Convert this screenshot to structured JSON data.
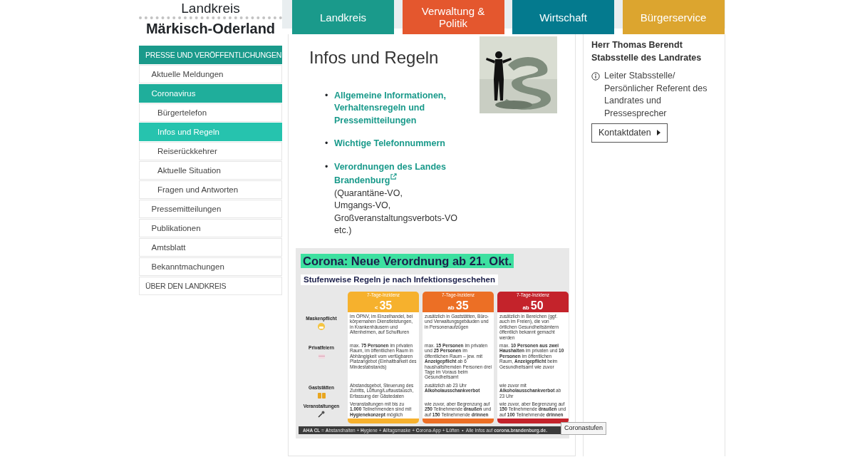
{
  "logo": {
    "line1": "Landkreis",
    "line2": "Märkisch-Oderland"
  },
  "nav_tabs": [
    {
      "label": "Landkreis",
      "color": "#1a9a8b"
    },
    {
      "label": "Verwaltung & Politik",
      "color": "#e4572e"
    },
    {
      "label": "Wirtschaft",
      "color": "#047a8e"
    },
    {
      "label": "Bürgerservice",
      "color": "#dca52f"
    }
  ],
  "sidebar": {
    "items": [
      {
        "label": "PRESSE UND VERÖFFENTLICHUNGEN",
        "expanded": true,
        "selected": false,
        "children": [
          {
            "label": "Aktuelle Meldungen",
            "expanded": false,
            "selected": false
          },
          {
            "label": "Coronavirus",
            "expanded": true,
            "selected": false,
            "children": [
              {
                "label": "Bürgertelefon",
                "expanded": false,
                "selected": false
              },
              {
                "label": "Infos und Regeln",
                "expanded": false,
                "selected": true
              },
              {
                "label": "Reiserückkehrer",
                "expanded": false,
                "selected": false
              },
              {
                "label": "Aktuelle Situation",
                "expanded": false,
                "selected": false
              },
              {
                "label": "Fragen und Antworten",
                "expanded": false,
                "selected": false
              }
            ]
          },
          {
            "label": "Pressemitteilungen",
            "expanded": false,
            "selected": false
          },
          {
            "label": "Publikationen",
            "expanded": false,
            "selected": false
          },
          {
            "label": "Amtsblatt",
            "expanded": false,
            "selected": false
          },
          {
            "label": "Bekanntmachungen",
            "expanded": false,
            "selected": false
          }
        ]
      },
      {
        "label": "ÜBER DEN LANDKREIS",
        "expanded": false,
        "selected": false
      }
    ]
  },
  "main": {
    "title": "Infos und Regeln",
    "links": [
      {
        "bullet": "•",
        "text": "Allgemeine Informationen, Verhaltensregeln und Pressemitteilungen",
        "external": false
      },
      {
        "bullet": "•",
        "text": "Wichtige Telefonnummern",
        "external": false
      },
      {
        "bullet": "•",
        "text": "Verordnungen des Landes Brandenburg",
        "external": true,
        "note": "(Quarantäne-VO, Umgangs-VO, Großveranstaltungsverbots-VO etc.)"
      }
    ],
    "infographic": {
      "title": "Corona: Neue Verordnung ab 21. Okt.",
      "subtitle": "Stufenweise Regeln je nach Infektionsgeschehen",
      "tiers": [
        {
          "caption": "7-Tage-Inzidenz",
          "prefix": "<",
          "number": "35",
          "color": "#f6b12d"
        },
        {
          "caption": "7-Tage-Inzidenz",
          "prefix": "ab",
          "number": "35",
          "color": "#ec6f25"
        },
        {
          "caption": "7-Tage-Inzidenz",
          "prefix": "ab",
          "number": "50",
          "color": "#c4232b"
        }
      ],
      "rows": [
        {
          "label": "Maskenpflicht",
          "cells": [
            "im ÖPNV, im Einzelhandel, bei körpernahen Dienstleistungen, in Krankenhäusern und Altenheimen, auf Schulfluren",
            "zusätzlich in Gaststätten, Büro- und Verwaltungsgebäuden und in Personenaufzügen",
            "zusätzlich in Bereichen (ggf. auch im Freien), die von örtlichen Gesundheitsämtern öffentlich bekannt gemacht werden"
          ]
        },
        {
          "label": "Privatfeiern",
          "cells": [
            "max. **75 Personen** im privaten Raum, im öffentlichen Raum in Abhängigkeit vom verfügbaren Platzangebot (Einhaltbarkeit des Mindestabstands)",
            "max. **15 Personen** im privaten und **25 Personen** im öffentlichen Raum – jew. mit **Anzeigepflicht** ab 6 haushaltsfremden Personen drei Tage im Voraus beim Gesundheitsamt",
            "max. **10 Personen aus zwei Haushalten** im privaten und **10 Personen** im öffentlichen Raum, **Anzeigepflicht** beim Gesundheitsamt wie zuvor"
          ]
        },
        {
          "label": "Gaststätten",
          "cells": [
            "Abstandsgebot, Steuerung des Zutritts, Lüftung/Luftaustausch, Erfassung der Gästedaten",
            "zusätzlich ab 23 Uhr **Alkoholausschankverbot**",
            "wie zuvor mit **Alkoholausschankverbot** ab 23 Uhr"
          ]
        },
        {
          "label": "Veranstaltungen",
          "cells": [
            "Veranstaltungen mit bis zu **1.000** Teilnehmenden sind mit **Hygienekonzept** möglich",
            "wie zuvor, aber Begrenzung auf **250** Teilnehmende **draußen** und auf **150** Teilnehmende **drinnen**",
            "wie zuvor, aber Begrenzung auf **150** Teilnehmende **draußen** und auf **100** Teilnehmende **drinnen**"
          ]
        }
      ],
      "footer": "**AHA CL** = **A**bstandhalten + **H**ygiene + **A**lltagsmaske + **C**orona-App + **L**üften  •  Alle Infos auf **corona.brandenburg.de.**",
      "tooltip": "Coronastufen"
    }
  },
  "contact": {
    "name": "Herr Thomas Berendt",
    "unit": "Stabsstelle des Landrates",
    "role": "Leiter Stabsstelle/ Persönlicher Referent des Landrates und Pressesprecher",
    "button": "Kontaktdaten"
  }
}
